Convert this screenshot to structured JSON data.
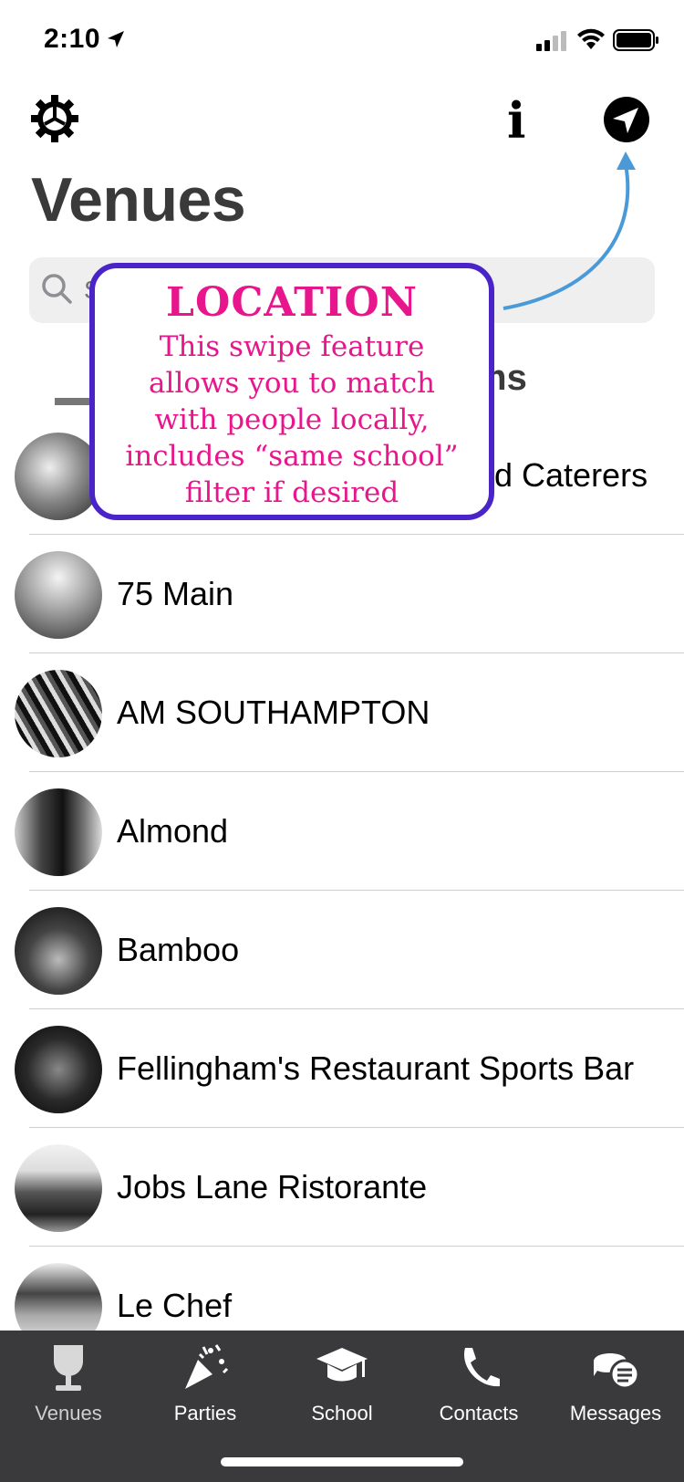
{
  "status_bar": {
    "time": "2:10"
  },
  "header": {
    "title": "Venues",
    "info_glyph": "i"
  },
  "search": {
    "placeholder": "Search"
  },
  "segment": {
    "visible_label": "ms"
  },
  "callout": {
    "title": "LOCATION",
    "lines": [
      "This swipe feature",
      "allows you to match",
      "with people locally,",
      "includes “same school”",
      "filter if desired"
    ],
    "border_color": "#4a24c8",
    "text_color": "#e8168d"
  },
  "venues": [
    {
      "name": "d Caterers"
    },
    {
      "name": "75 Main"
    },
    {
      "name": "AM SOUTHAMPTON"
    },
    {
      "name": "Almond"
    },
    {
      "name": "Bamboo"
    },
    {
      "name": "Fellingham's Restaurant Sports Bar"
    },
    {
      "name": "Jobs Lane Ristorante"
    },
    {
      "name": "Le Chef"
    }
  ],
  "tabs": [
    {
      "label": "Venues",
      "icon": "wine-glass-icon",
      "active": true
    },
    {
      "label": "Parties",
      "icon": "party-popper-icon",
      "active": false
    },
    {
      "label": "School",
      "icon": "graduation-cap-icon",
      "active": false
    },
    {
      "label": "Contacts",
      "icon": "phone-icon",
      "active": false
    },
    {
      "label": "Messages",
      "icon": "chat-bubbles-icon",
      "active": false
    }
  ],
  "colors": {
    "tabbar_bg": "#3a3a3c",
    "arrow": "#4a9ad8",
    "title": "#3a3a3a"
  }
}
